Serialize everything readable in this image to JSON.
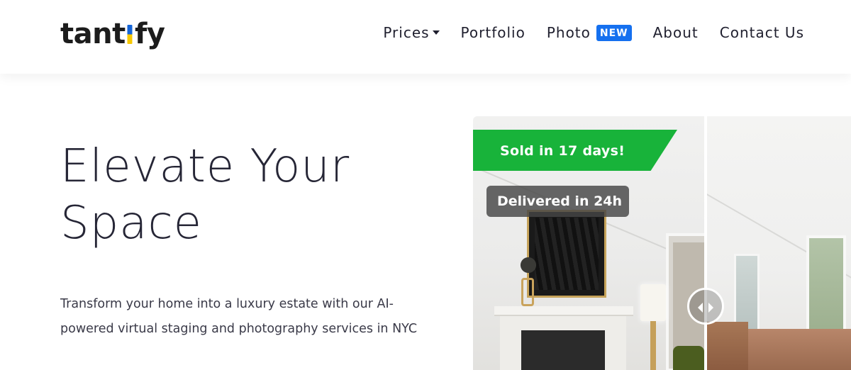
{
  "brand": {
    "logo_text_before": "tant",
    "logo_text_i": "i",
    "logo_text_after": "fy"
  },
  "nav": {
    "items": [
      {
        "label": "Prices",
        "has_dropdown": true
      },
      {
        "label": "Portfolio"
      },
      {
        "label": "Photo",
        "badge": "NEW"
      },
      {
        "label": "About"
      },
      {
        "label": "Contact Us"
      }
    ]
  },
  "hero": {
    "title_line1": "Elevate Your",
    "title_line2": "Space",
    "subtitle": "Transform your home into a luxury estate with our AI-powered virtual staging and photography services in NYC"
  },
  "comparison": {
    "sold_label": "Sold in 17 days!",
    "delivered_label": "Delivered in 24h"
  },
  "colors": {
    "badge_blue": "#1570ef",
    "sold_green": "#18b33a",
    "logo_blue": "#1565d8",
    "logo_yellow": "#f7c800",
    "text_dark": "#1f1f2e"
  },
  "icons": {
    "dropdown": "caret-down-icon",
    "slider_handle": "compare-slider-icon"
  }
}
